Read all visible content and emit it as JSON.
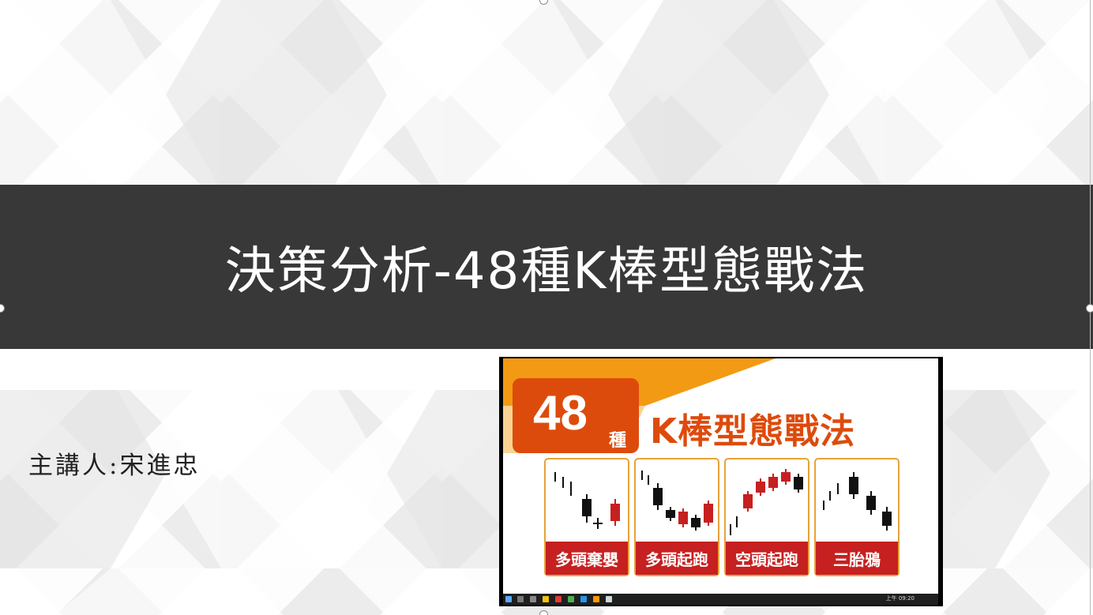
{
  "slide": {
    "title": "決策分析-48種K棒型態戰法",
    "presenter": "主講人:宋進忠"
  },
  "embedded_image": {
    "badge_number": "48",
    "badge_unit": "種",
    "headline": "K棒型態戰法",
    "window_controls": "— ▫ ✕",
    "taskbar_time": "上午 09:20",
    "panels": [
      {
        "label": "多頭棄嬰"
      },
      {
        "label": "多頭起跑"
      },
      {
        "label": "空頭起跑"
      },
      {
        "label": "三胎鴉"
      }
    ],
    "colors": {
      "orange": "#dd4b0c",
      "red": "#c62020",
      "gold": "#e8a23a",
      "title_bar": "#383838"
    }
  }
}
